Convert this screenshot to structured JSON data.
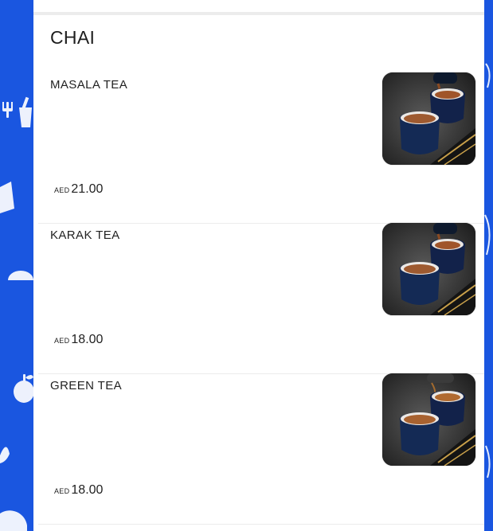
{
  "section": {
    "title": "CHAI"
  },
  "items": [
    {
      "name": "MASALA TEA",
      "currency": "AED",
      "price": "21.00",
      "image_icon": "tea-cups-photo"
    },
    {
      "name": "KARAK TEA",
      "currency": "AED",
      "price": "18.00",
      "image_icon": "tea-cups-photo"
    },
    {
      "name": "GREEN TEA",
      "currency": "AED",
      "price": "18.00",
      "image_icon": "tea-cups-photo"
    }
  ],
  "colors": {
    "background": "#1a56e0",
    "panel": "#ffffff",
    "divider": "#ececec",
    "text": "#222222"
  }
}
